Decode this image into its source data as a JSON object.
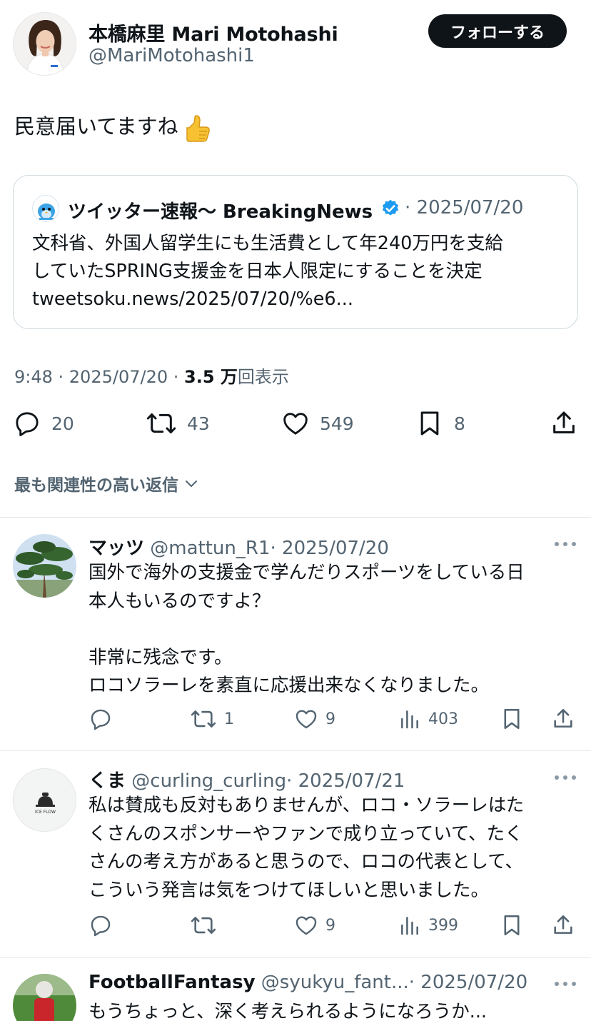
{
  "post": {
    "author_name": "本橋麻里 Mari Motohashi",
    "author_handle": "@MariMotohashi1",
    "follow_label": "フォローする",
    "text": "民意届いてますね",
    "thumb_emoji": "👍",
    "quote": {
      "name": "ツイッター速報〜 BreakingNews",
      "date": "· 2025/07/20",
      "lines": [
        "文科省、外国人留学生にも生活費として年240万円を支給",
        "していたSPRING支援金を日本人限定にすることを決定",
        "tweetsoku.news/2025/07/20/%e6..."
      ]
    },
    "meta_time": "9:48 · 2025/07/20 · ",
    "meta_views": "3.5 万",
    "meta_views_suffix": "回表示",
    "stats": {
      "replies": "20",
      "retweets": "43",
      "likes": "549",
      "bookmarks": "8"
    }
  },
  "sort_label": "最も関連性の高い返信",
  "replies": [
    {
      "name": "マッツ",
      "handle": "@mattun_R1",
      "date": "· 2025/07/20",
      "lines": [
        "国外で海外の支援金で学んだりスポーツをしている日",
        "本人もいるのですよ？",
        "",
        "非常に残念です。",
        "ロコソラーレを素直に応援出来なくなりました。"
      ],
      "replies": "",
      "retweets": "1",
      "likes": "9",
      "views": "403"
    },
    {
      "name": "くま",
      "handle": "@curling_curling",
      "date": "· 2025/07/21",
      "avatar_text": "ICE FLOW",
      "lines": [
        "私は賛成も反対もありませんが、ロコ・ソラーレはた",
        "くさんのスポンサーやファンで成り立っていて、たく",
        "さんの考え方があると思うので、ロコの代表として、",
        "こういう発言は気をつけてほしいと思いました。"
      ],
      "replies": "",
      "retweets": "",
      "likes": "9",
      "views": "399"
    },
    {
      "name": "FootballFantasy",
      "handle": "@syukyu_fant...",
      "date": "· 2025/07/20",
      "lines": [
        "もうちょっと、深く考えられるようになろうか..."
      ]
    }
  ],
  "colors": {
    "text": "#0f1419",
    "muted": "#536471",
    "verified": "#1d9bf0",
    "follow_bg": "#0f1419"
  }
}
